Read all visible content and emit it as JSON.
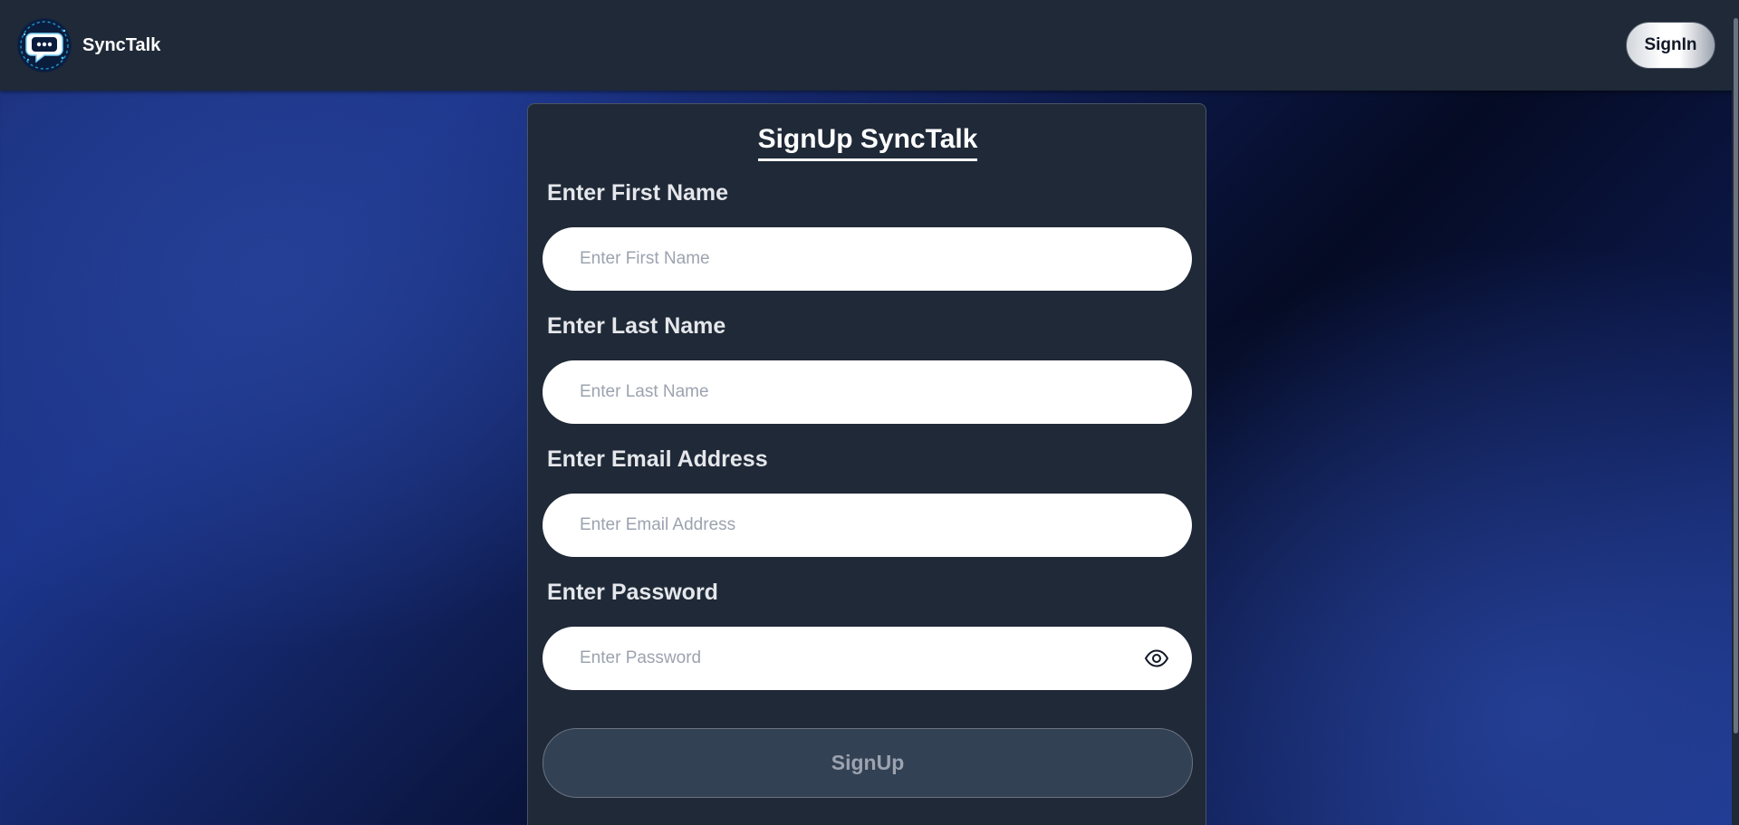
{
  "navbar": {
    "brand_name": "SyncTalk",
    "signin_label": "SignIn"
  },
  "form": {
    "title": "SignUp SyncTalk",
    "first_name": {
      "label": "Enter First Name",
      "placeholder": "Enter First Name",
      "value": ""
    },
    "last_name": {
      "label": "Enter Last Name",
      "placeholder": "Enter Last Name",
      "value": ""
    },
    "email": {
      "label": "Enter Email Address",
      "placeholder": "Enter Email Address",
      "value": ""
    },
    "password": {
      "label": "Enter Password",
      "placeholder": "Enter Password",
      "value": ""
    },
    "submit_label": "SignUp"
  },
  "icons": {
    "logo": "chat-bubble-logo-icon",
    "password_toggle": "eye-icon"
  },
  "colors": {
    "navbar_bg": "#1f2937",
    "card_bg": "#1f2937",
    "submit_bg": "#334155",
    "background_blue": "#1d3a96"
  }
}
